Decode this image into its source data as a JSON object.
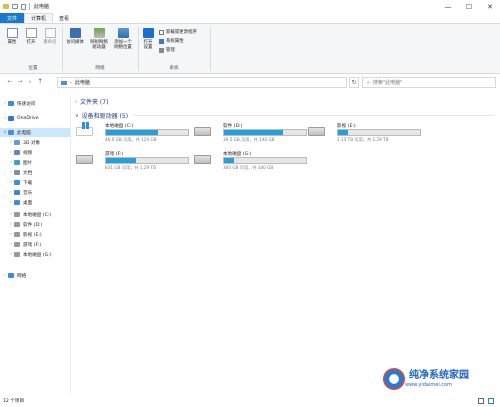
{
  "window": {
    "title": "此电脑",
    "minimize": "—",
    "maximize": "☐",
    "close": "✕"
  },
  "tabs": {
    "file": "文件",
    "computer": "计算机",
    "view": "查看"
  },
  "ribbon": {
    "buttons": {
      "properties": "属性",
      "open": "打开",
      "rename": "重命名",
      "access_media": "访问媒体",
      "map_drive_1": "映射网络",
      "map_drive_2": "驱动器",
      "add_location_1": "添加一个",
      "add_location_2": "网络位置",
      "open_settings_1": "打开",
      "open_settings_2": "设置",
      "uninstall": "卸载或更改程序",
      "system_props": "系统属性",
      "manage": "管理"
    },
    "groups": {
      "location": "位置",
      "network": "网络",
      "system": "系统"
    }
  },
  "address": {
    "back": "←",
    "forward": "→",
    "dropdown": "∨",
    "up": "↑",
    "path": "此电脑",
    "search_placeholder": "搜索\"此电脑\"",
    "refresh": "↻"
  },
  "nav": {
    "items": [
      {
        "label": "快速访问",
        "color": "#3c8de0"
      },
      {
        "label": "OneDrive",
        "color": "#2f78d4"
      },
      {
        "label": "此电脑",
        "color": "#4a90d9"
      },
      {
        "label": "3D 对象",
        "color": "#5aa0e0"
      },
      {
        "label": "视频",
        "color": "#6a7fc8"
      },
      {
        "label": "图片",
        "color": "#3ca0d0"
      },
      {
        "label": "文档",
        "color": "#7a8fa8"
      },
      {
        "label": "下载",
        "color": "#3c8de0"
      },
      {
        "label": "音乐",
        "color": "#4a7fd0"
      },
      {
        "label": "桌面",
        "color": "#3c8de0"
      },
      {
        "label": "本地磁盘 (C:)",
        "color": "#999999"
      },
      {
        "label": "软件 (D:)",
        "color": "#999999"
      },
      {
        "label": "影视 (E:)",
        "color": "#999999"
      },
      {
        "label": "游戏 (F:)",
        "color": "#999999"
      },
      {
        "label": "本地磁盘 (G:)",
        "color": "#999999"
      },
      {
        "label": "网络",
        "color": "#3c8de0"
      }
    ]
  },
  "content": {
    "folders_header": "文件夹 (7)",
    "drives_header": "设备和驱动器 (5)",
    "drives": [
      {
        "name": "本地磁盘 (C:)",
        "info": "46.0 GB 可用，共 124 GB",
        "used": 0.63,
        "system": true
      },
      {
        "name": "软件 (D:)",
        "info": "39.5 GB 可用，共 140 GB",
        "used": 0.72,
        "system": false
      },
      {
        "name": "影视 (E:)",
        "info": "1.13 TB 可用，共 1.29 TB",
        "used": 0.12,
        "system": false
      },
      {
        "name": "游戏 (F:)",
        "info": "831 GB 可用，共 1.29 TB",
        "used": 0.37,
        "system": false
      },
      {
        "name": "本地磁盘 (G:)",
        "info": "300 GB 可用，共 340 GB",
        "used": 0.12,
        "system": false
      }
    ]
  },
  "status": {
    "count": "12 个项目"
  },
  "watermark": {
    "brand": "纯净系统家园",
    "url": "www.yidaimei.com"
  }
}
